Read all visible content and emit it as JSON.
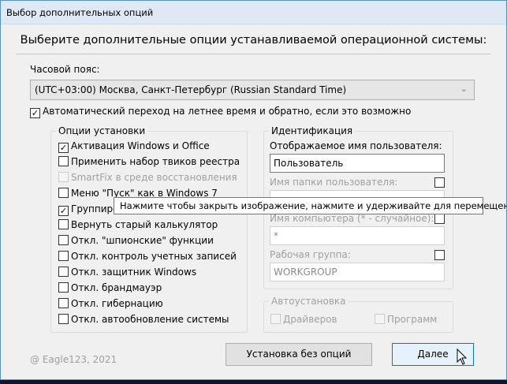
{
  "window": {
    "title": "Выбор дополнительных опций"
  },
  "heading": "Выберите дополнительные опции устанавливаемой операционной системы:",
  "timezone": {
    "label": "Часовой пояс:",
    "value": "(UTC+03:00) Москва, Санкт-Петербург (Russian Standard Time)"
  },
  "dst": {
    "label": "Автоматический переход на летнее время и обратно, если это возможно",
    "checked": true
  },
  "options": {
    "legend": "Опции установки",
    "items": [
      {
        "label": "Активация Windows и Office",
        "checked": true,
        "enabled": true
      },
      {
        "label": "Применить набор твиков реестра",
        "checked": false,
        "enabled": true
      },
      {
        "label": "SmartFix в среде восстановления",
        "checked": false,
        "enabled": false
      },
      {
        "label": "Меню \"Пуск\" как в Windows 7",
        "checked": false,
        "enabled": true
      },
      {
        "label": "Группиро",
        "checked": true,
        "enabled": true
      },
      {
        "label": "Вернуть старый калькулятор",
        "checked": false,
        "enabled": true
      },
      {
        "label": "Откл. \"шпионские\" функции",
        "checked": false,
        "enabled": true
      },
      {
        "label": "Откл. контроль учетных записей",
        "checked": false,
        "enabled": true
      },
      {
        "label": "Откл. защитник Windows",
        "checked": false,
        "enabled": true
      },
      {
        "label": "Откл. брандмауэр",
        "checked": false,
        "enabled": true
      },
      {
        "label": "Откл. гибернацию",
        "checked": false,
        "enabled": true
      },
      {
        "label": "Откл. автообновление системы",
        "checked": false,
        "enabled": true
      }
    ]
  },
  "identity": {
    "legend": "Идентификация",
    "display_name_label": "Отображаемое имя пользователя:",
    "display_name": "Пользователь",
    "folder_label": "Имя папки пользователя:",
    "folder_value": "",
    "computer_label": "Имя компьютера (* - случайное):",
    "computer_value": "*",
    "workgroup_label": "Рабочая группа:",
    "workgroup_value": "WORKGROUP"
  },
  "autoinstall": {
    "legend": "Автоустановка",
    "drivers": "Драйверов",
    "programs": "Программ"
  },
  "tooltip": "Нажмите чтобы закрыть изображение, нажмите и удерживайте для перемещения",
  "footer": {
    "copyright": "@ Eagle123, 2021",
    "no_options_button": "Установка без опций",
    "next_button": "Далее"
  }
}
